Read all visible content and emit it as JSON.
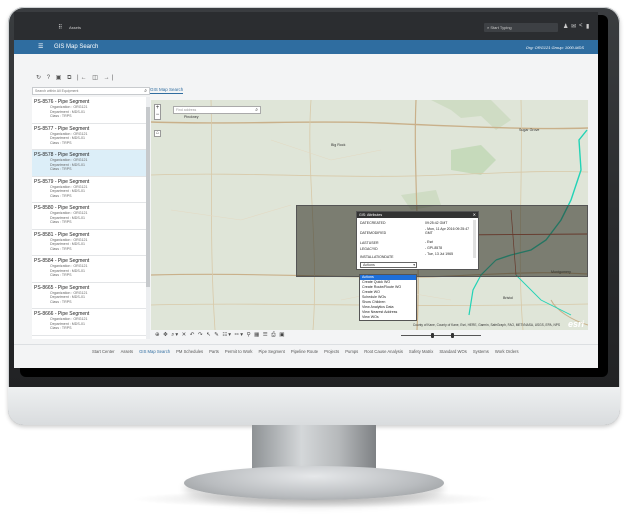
{
  "topbar": {
    "brand": "Assets",
    "search_placeholder": "Start Typing"
  },
  "titlebar": {
    "title": "GIS Map Search",
    "org_info": "Org: ORG121 Group: 1000-MDS"
  },
  "equipment": {
    "search_placeholder": "Search within All Equipment",
    "items": [
      {
        "title": "PS-8576 - Pipe Segment",
        "org": "Organization : ORG121",
        "dept": "Department : MDS-01",
        "class": "Class : TRPS",
        "selected": false
      },
      {
        "title": "PS-8577 - Pipe Segment",
        "org": "Organization : ORG121",
        "dept": "Department : MDS-01",
        "class": "Class : TRPS",
        "selected": false
      },
      {
        "title": "PS-8578 - Pipe Segment",
        "org": "Organization : ORG121",
        "dept": "Department : MDS-01",
        "class": "Class : TRPS",
        "selected": true
      },
      {
        "title": "PS-8579 - Pipe Segment",
        "org": "Organization : ORG121",
        "dept": "Department : MDS-01",
        "class": "Class : TRPS",
        "selected": false
      },
      {
        "title": "PS-8580 - Pipe Segment",
        "org": "Organization : ORG121",
        "dept": "Department : MDS-01",
        "class": "Class : TRPS",
        "selected": false
      },
      {
        "title": "PS-8581 - Pipe Segment",
        "org": "Organization : ORG121",
        "dept": "Department : MDS-01",
        "class": "Class : TRPS",
        "selected": false
      },
      {
        "title": "PS-8584 - Pipe Segment",
        "org": "Organization : ORG121",
        "dept": "Department : MDS-01",
        "class": "Class : TRPS",
        "selected": false
      },
      {
        "title": "PS-8665 - Pipe Segment",
        "org": "Organization : ORG121",
        "dept": "Department : MDS-01",
        "class": "Class : TRPS",
        "selected": false
      },
      {
        "title": "PS-8666 - Pipe Segment",
        "org": "Organization : ORG121",
        "dept": "Department : MDS-01",
        "class": "Class : TRPS",
        "selected": false
      }
    ]
  },
  "map": {
    "tab_label": "GIS Map Search",
    "find_placeholder": "Find address",
    "places": [
      "Pinckney",
      "Big Rock",
      "Sugar Grove",
      "Bristol",
      "Montgomery"
    ],
    "attribution": "County of Kane, County of Kane, Esri, HERE, Garmin, SafeGraph, FAO, METI/NASA, USGS, EPA, NPS",
    "logo": "esri"
  },
  "gis_popup": {
    "title": "GIS: Attributes",
    "rows": [
      {
        "label": "DATECREATED",
        "value": "09:25:42 GMT"
      },
      {
        "label": "DATEMODIFIED",
        "value": "- Mon, 11 Apr 2016 09:25:47 GMT"
      },
      {
        "label": "LASTUSER",
        "value": "- Esri"
      },
      {
        "label": "LEGACYID",
        "value": "- GPI-8578"
      },
      {
        "label": "INSTALLATIONDATE",
        "value": "- Tue, 13 Jul 1965"
      }
    ],
    "actions_label": "Actions"
  },
  "actions_menu": {
    "items": [
      {
        "label": "Actions",
        "selected": true
      },
      {
        "label": "Create Quick WO",
        "selected": false
      },
      {
        "label": "Create Route/Route WO",
        "selected": false
      },
      {
        "label": "Create WO",
        "selected": false
      },
      {
        "label": "Schedule WOs",
        "selected": false
      },
      {
        "label": "Show Children",
        "selected": false
      },
      {
        "label": "View Analytics Data",
        "selected": false
      },
      {
        "label": "View Nearest Address",
        "selected": false
      },
      {
        "label": "View WOs",
        "selected": false
      }
    ]
  },
  "bottom_nav": {
    "tabs": [
      {
        "label": "Start Center",
        "active": false
      },
      {
        "label": "Assets",
        "active": false
      },
      {
        "label": "GIS Map Search",
        "active": true
      },
      {
        "label": "PM Schedules",
        "active": false
      },
      {
        "label": "Parts",
        "active": false
      },
      {
        "label": "Permit to Work",
        "active": false
      },
      {
        "label": "Pipe Segment",
        "active": false
      },
      {
        "label": "Pipeline Route",
        "active": false
      },
      {
        "label": "Projects",
        "active": false
      },
      {
        "label": "Pumps",
        "active": false
      },
      {
        "label": "Root Cause Analysis",
        "active": false
      },
      {
        "label": "Safety Matrix",
        "active": false
      },
      {
        "label": "Standard WOs",
        "active": false
      },
      {
        "label": "Systems",
        "active": false
      },
      {
        "label": "Work Orders",
        "active": false
      }
    ]
  },
  "colors": {
    "titlebar": "#2f6da0",
    "topbar": "#2b2d30",
    "selected_row": "#dceef8",
    "pipeline_cyan": "#22d3b6",
    "pipeline_red": "#b04a3a"
  }
}
